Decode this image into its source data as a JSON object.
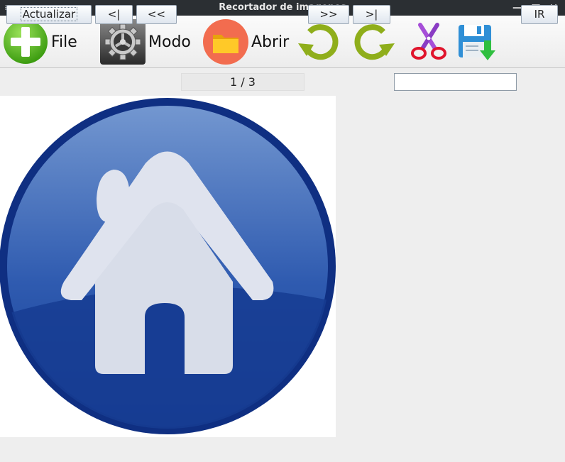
{
  "window": {
    "title": "Recortador de imagenes",
    "menu_glyph": "≡",
    "minimize_glyph": "—",
    "maximize_glyph": "□",
    "close_glyph": "✕"
  },
  "toolbar": {
    "file_label": "File",
    "file_icon": "add-icon",
    "mode_label": "Modo",
    "mode_icon": "gear-icon",
    "open_label": "Abrir",
    "open_icon": "folder-icon",
    "rotate_left_icon": "rotate-left-icon",
    "rotate_right_icon": "rotate-right-icon",
    "cut_icon": "scissors-icon",
    "save_icon": "save-icon"
  },
  "navigation": {
    "refresh_label": "Actualizar",
    "first_label": "<|",
    "prev_label": "<<",
    "page_indicator": "1 / 3",
    "next_label": ">>",
    "last_label": ">|",
    "goto_value": "",
    "go_label": "IR"
  },
  "canvas": {
    "image": "home-icon"
  },
  "colors": {
    "titlebar": "#2b2f33",
    "add_green": "#4fb81c",
    "open_orange": "#f26c4f",
    "rotate_olive": "#8fae1b",
    "home_blue": "#1c3f95"
  }
}
